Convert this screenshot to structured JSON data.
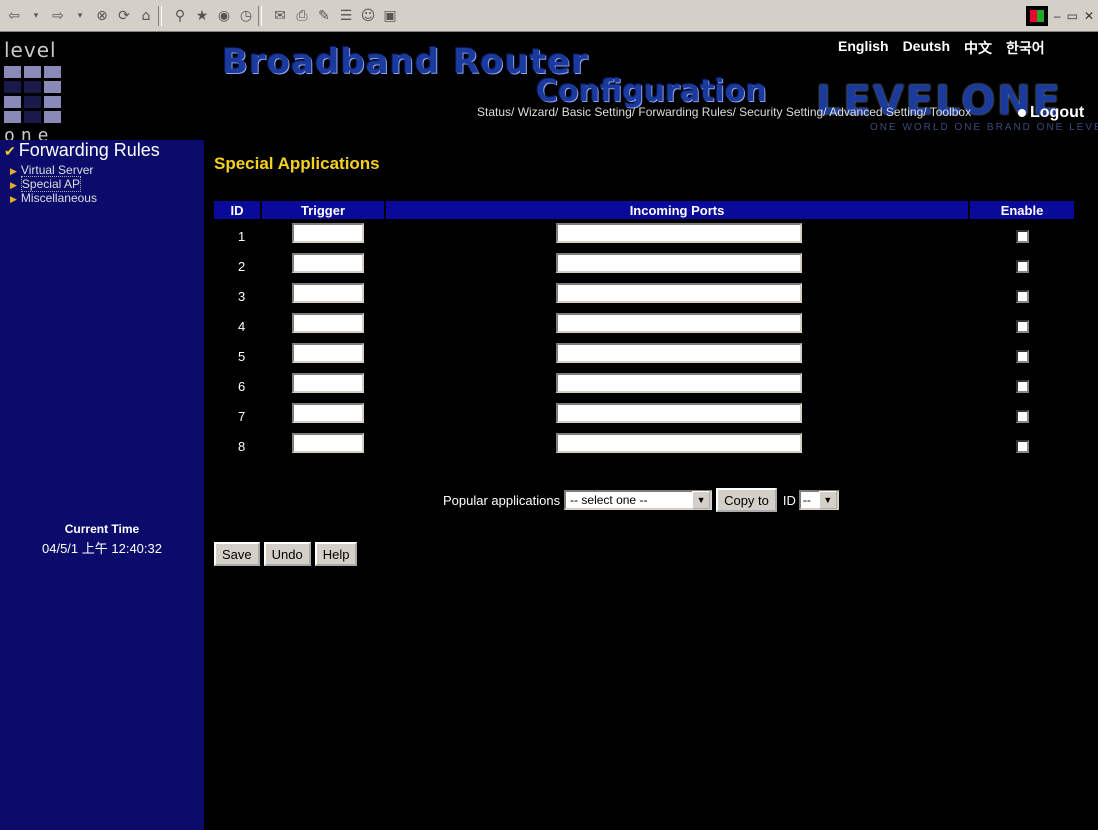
{
  "colors": {
    "sidebar": "#0b0b6b",
    "header_bar": "#0a0a9a",
    "title": "#f5d020",
    "background": "#000000"
  },
  "toolbar": {
    "icons": [
      "back-icon",
      "forward-icon",
      "stop-icon",
      "refresh-icon",
      "home-icon",
      "search-icon",
      "favorites-icon",
      "media-icon",
      "history-icon",
      "mail-icon",
      "print-icon",
      "edit-icon",
      "discuss-icon",
      "messenger-icon",
      "research-icon"
    ]
  },
  "header": {
    "brand_title": "Broadband Router",
    "brand_sub": "Configuration",
    "logo_text": "level",
    "logo_one": "one",
    "levelone": "LEVELONE",
    "slogan": "ONE WORLD ONE BRAND ONE LEVEL",
    "logout": "Logout",
    "languages": [
      "English",
      "Deutsh",
      "中文",
      "한국어"
    ],
    "nav": [
      "Status/ ",
      "Wizard/ ",
      "Basic Setting/ ",
      "Forwarding Rules/ ",
      "Security Setting/ ",
      "Advanced Setting/ ",
      "Toolbox"
    ]
  },
  "sidebar": {
    "title": "Forwarding Rules",
    "items": [
      {
        "label": "Virtual Server"
      },
      {
        "label": "Special AP"
      },
      {
        "label": "Miscellaneous"
      }
    ],
    "time_label": "Current Time",
    "time_value": "04/5/1 上午 12:40:32"
  },
  "main": {
    "title": "Special Applications",
    "columns": [
      "ID",
      "Trigger",
      "Incoming Ports",
      "Enable"
    ],
    "rows": [
      {
        "id": "1",
        "trigger": "",
        "ports": ""
      },
      {
        "id": "2",
        "trigger": "",
        "ports": ""
      },
      {
        "id": "3",
        "trigger": "",
        "ports": ""
      },
      {
        "id": "4",
        "trigger": "",
        "ports": ""
      },
      {
        "id": "5",
        "trigger": "",
        "ports": ""
      },
      {
        "id": "6",
        "trigger": "",
        "ports": ""
      },
      {
        "id": "7",
        "trigger": "",
        "ports": ""
      },
      {
        "id": "8",
        "trigger": "",
        "ports": ""
      }
    ],
    "popular_label": "Popular applications",
    "popular_select": "-- select one --",
    "copy_label": "Copy to",
    "id_label": "ID",
    "id_select": "--",
    "buttons": {
      "save": "Save",
      "undo": "Undo",
      "help": "Help"
    }
  }
}
